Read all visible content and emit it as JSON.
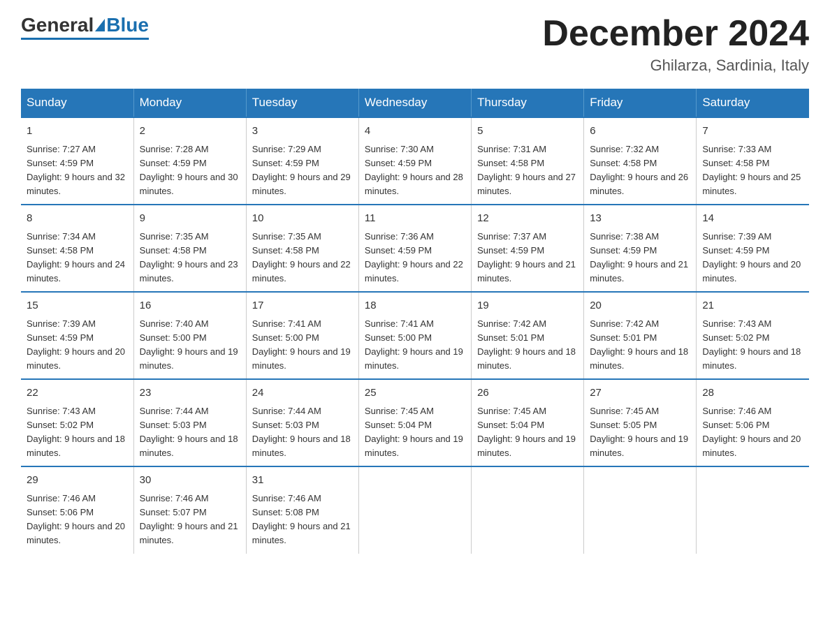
{
  "header": {
    "logo_general": "General",
    "logo_blue": "Blue",
    "month_title": "December 2024",
    "location": "Ghilarza, Sardinia, Italy"
  },
  "weekdays": [
    "Sunday",
    "Monday",
    "Tuesday",
    "Wednesday",
    "Thursday",
    "Friday",
    "Saturday"
  ],
  "weeks": [
    [
      {
        "day": "1",
        "sunrise": "7:27 AM",
        "sunset": "4:59 PM",
        "daylight": "9 hours and 32 minutes."
      },
      {
        "day": "2",
        "sunrise": "7:28 AM",
        "sunset": "4:59 PM",
        "daylight": "9 hours and 30 minutes."
      },
      {
        "day": "3",
        "sunrise": "7:29 AM",
        "sunset": "4:59 PM",
        "daylight": "9 hours and 29 minutes."
      },
      {
        "day": "4",
        "sunrise": "7:30 AM",
        "sunset": "4:59 PM",
        "daylight": "9 hours and 28 minutes."
      },
      {
        "day": "5",
        "sunrise": "7:31 AM",
        "sunset": "4:58 PM",
        "daylight": "9 hours and 27 minutes."
      },
      {
        "day": "6",
        "sunrise": "7:32 AM",
        "sunset": "4:58 PM",
        "daylight": "9 hours and 26 minutes."
      },
      {
        "day": "7",
        "sunrise": "7:33 AM",
        "sunset": "4:58 PM",
        "daylight": "9 hours and 25 minutes."
      }
    ],
    [
      {
        "day": "8",
        "sunrise": "7:34 AM",
        "sunset": "4:58 PM",
        "daylight": "9 hours and 24 minutes."
      },
      {
        "day": "9",
        "sunrise": "7:35 AM",
        "sunset": "4:58 PM",
        "daylight": "9 hours and 23 minutes."
      },
      {
        "day": "10",
        "sunrise": "7:35 AM",
        "sunset": "4:58 PM",
        "daylight": "9 hours and 22 minutes."
      },
      {
        "day": "11",
        "sunrise": "7:36 AM",
        "sunset": "4:59 PM",
        "daylight": "9 hours and 22 minutes."
      },
      {
        "day": "12",
        "sunrise": "7:37 AM",
        "sunset": "4:59 PM",
        "daylight": "9 hours and 21 minutes."
      },
      {
        "day": "13",
        "sunrise": "7:38 AM",
        "sunset": "4:59 PM",
        "daylight": "9 hours and 21 minutes."
      },
      {
        "day": "14",
        "sunrise": "7:39 AM",
        "sunset": "4:59 PM",
        "daylight": "9 hours and 20 minutes."
      }
    ],
    [
      {
        "day": "15",
        "sunrise": "7:39 AM",
        "sunset": "4:59 PM",
        "daylight": "9 hours and 20 minutes."
      },
      {
        "day": "16",
        "sunrise": "7:40 AM",
        "sunset": "5:00 PM",
        "daylight": "9 hours and 19 minutes."
      },
      {
        "day": "17",
        "sunrise": "7:41 AM",
        "sunset": "5:00 PM",
        "daylight": "9 hours and 19 minutes."
      },
      {
        "day": "18",
        "sunrise": "7:41 AM",
        "sunset": "5:00 PM",
        "daylight": "9 hours and 19 minutes."
      },
      {
        "day": "19",
        "sunrise": "7:42 AM",
        "sunset": "5:01 PM",
        "daylight": "9 hours and 18 minutes."
      },
      {
        "day": "20",
        "sunrise": "7:42 AM",
        "sunset": "5:01 PM",
        "daylight": "9 hours and 18 minutes."
      },
      {
        "day": "21",
        "sunrise": "7:43 AM",
        "sunset": "5:02 PM",
        "daylight": "9 hours and 18 minutes."
      }
    ],
    [
      {
        "day": "22",
        "sunrise": "7:43 AM",
        "sunset": "5:02 PM",
        "daylight": "9 hours and 18 minutes."
      },
      {
        "day": "23",
        "sunrise": "7:44 AM",
        "sunset": "5:03 PM",
        "daylight": "9 hours and 18 minutes."
      },
      {
        "day": "24",
        "sunrise": "7:44 AM",
        "sunset": "5:03 PM",
        "daylight": "9 hours and 18 minutes."
      },
      {
        "day": "25",
        "sunrise": "7:45 AM",
        "sunset": "5:04 PM",
        "daylight": "9 hours and 19 minutes."
      },
      {
        "day": "26",
        "sunrise": "7:45 AM",
        "sunset": "5:04 PM",
        "daylight": "9 hours and 19 minutes."
      },
      {
        "day": "27",
        "sunrise": "7:45 AM",
        "sunset": "5:05 PM",
        "daylight": "9 hours and 19 minutes."
      },
      {
        "day": "28",
        "sunrise": "7:46 AM",
        "sunset": "5:06 PM",
        "daylight": "9 hours and 20 minutes."
      }
    ],
    [
      {
        "day": "29",
        "sunrise": "7:46 AM",
        "sunset": "5:06 PM",
        "daylight": "9 hours and 20 minutes."
      },
      {
        "day": "30",
        "sunrise": "7:46 AM",
        "sunset": "5:07 PM",
        "daylight": "9 hours and 21 minutes."
      },
      {
        "day": "31",
        "sunrise": "7:46 AM",
        "sunset": "5:08 PM",
        "daylight": "9 hours and 21 minutes."
      },
      null,
      null,
      null,
      null
    ]
  ]
}
